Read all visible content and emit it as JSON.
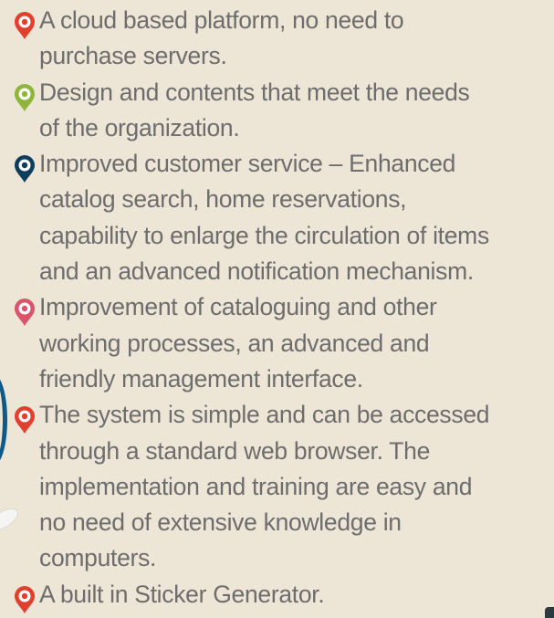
{
  "colors": {
    "background": "#ede5d6",
    "text": "#6d6d6d",
    "pin_red": "#e0402e",
    "pin_green": "#8fb53c",
    "pin_navy": "#0f3d5c",
    "pin_pink": "#d9556a"
  },
  "bullets": [
    {
      "icon": "red-pin-icon",
      "color": "#e0402e",
      "lines": [
        "A cloud based platform,  no need to",
        "purchase servers."
      ]
    },
    {
      "icon": "green-pin-icon",
      "color": "#8fb53c",
      "lines": [
        "Design and contents that meet the needs",
        "of the organization."
      ]
    },
    {
      "icon": "navy-pin-icon",
      "color": "#0f3d5c",
      "lines": [
        "Improved customer service – Enhanced",
        "catalog search, home reservations,",
        "capability to enlarge the circulation of items",
        "and an advanced notification mechanism."
      ]
    },
    {
      "icon": "pink-pin-icon",
      "color": "#d9556a",
      "lines": [
        "Improvement of cataloguing and other",
        "working processes, an advanced and",
        "friendly management interface."
      ]
    },
    {
      "icon": "red-pin-icon",
      "color": "#e0402e",
      "lines": [
        "The system is simple and can be accessed",
        "through a standard web browser. The",
        "implementation and training are easy and",
        "no need of extensive knowledge in",
        "computers."
      ]
    },
    {
      "icon": "red-pin-icon",
      "color": "#e0402e",
      "lines": [
        "A built in Sticker Generator."
      ]
    }
  ]
}
